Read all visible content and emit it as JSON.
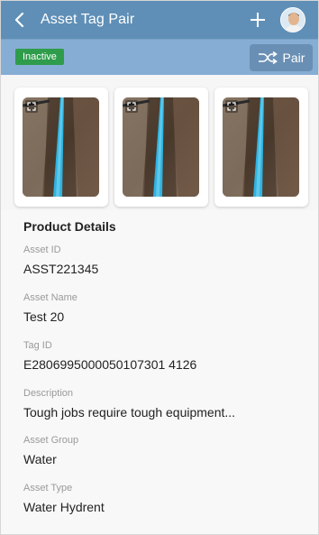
{
  "header": {
    "title": "Asset Tag Pair"
  },
  "subbar": {
    "status": "Inactive",
    "pair_label": "Pair"
  },
  "gallery": {
    "images": [
      "pipe-trench-photo",
      "pipe-trench-photo",
      "pipe-trench-photo"
    ]
  },
  "details": {
    "section_title": "Product Details",
    "fields": [
      {
        "label": "Asset ID",
        "value": "ASST221345"
      },
      {
        "label": "Asset Name",
        "value": "Test 20"
      },
      {
        "label": "Tag ID",
        "value": "E2806995000050107301 4126"
      },
      {
        "label": "Description",
        "value": "Tough jobs require tough equipment..."
      },
      {
        "label": "Asset Group",
        "value": "Water"
      },
      {
        "label": "Asset Type",
        "value": "Water Hydrent"
      }
    ]
  },
  "colors": {
    "header_bg": "#5f8fb7",
    "subbar_bg": "#86add3",
    "status_green": "#2e9c4a",
    "pipe_blue": "#2fb3e0"
  }
}
